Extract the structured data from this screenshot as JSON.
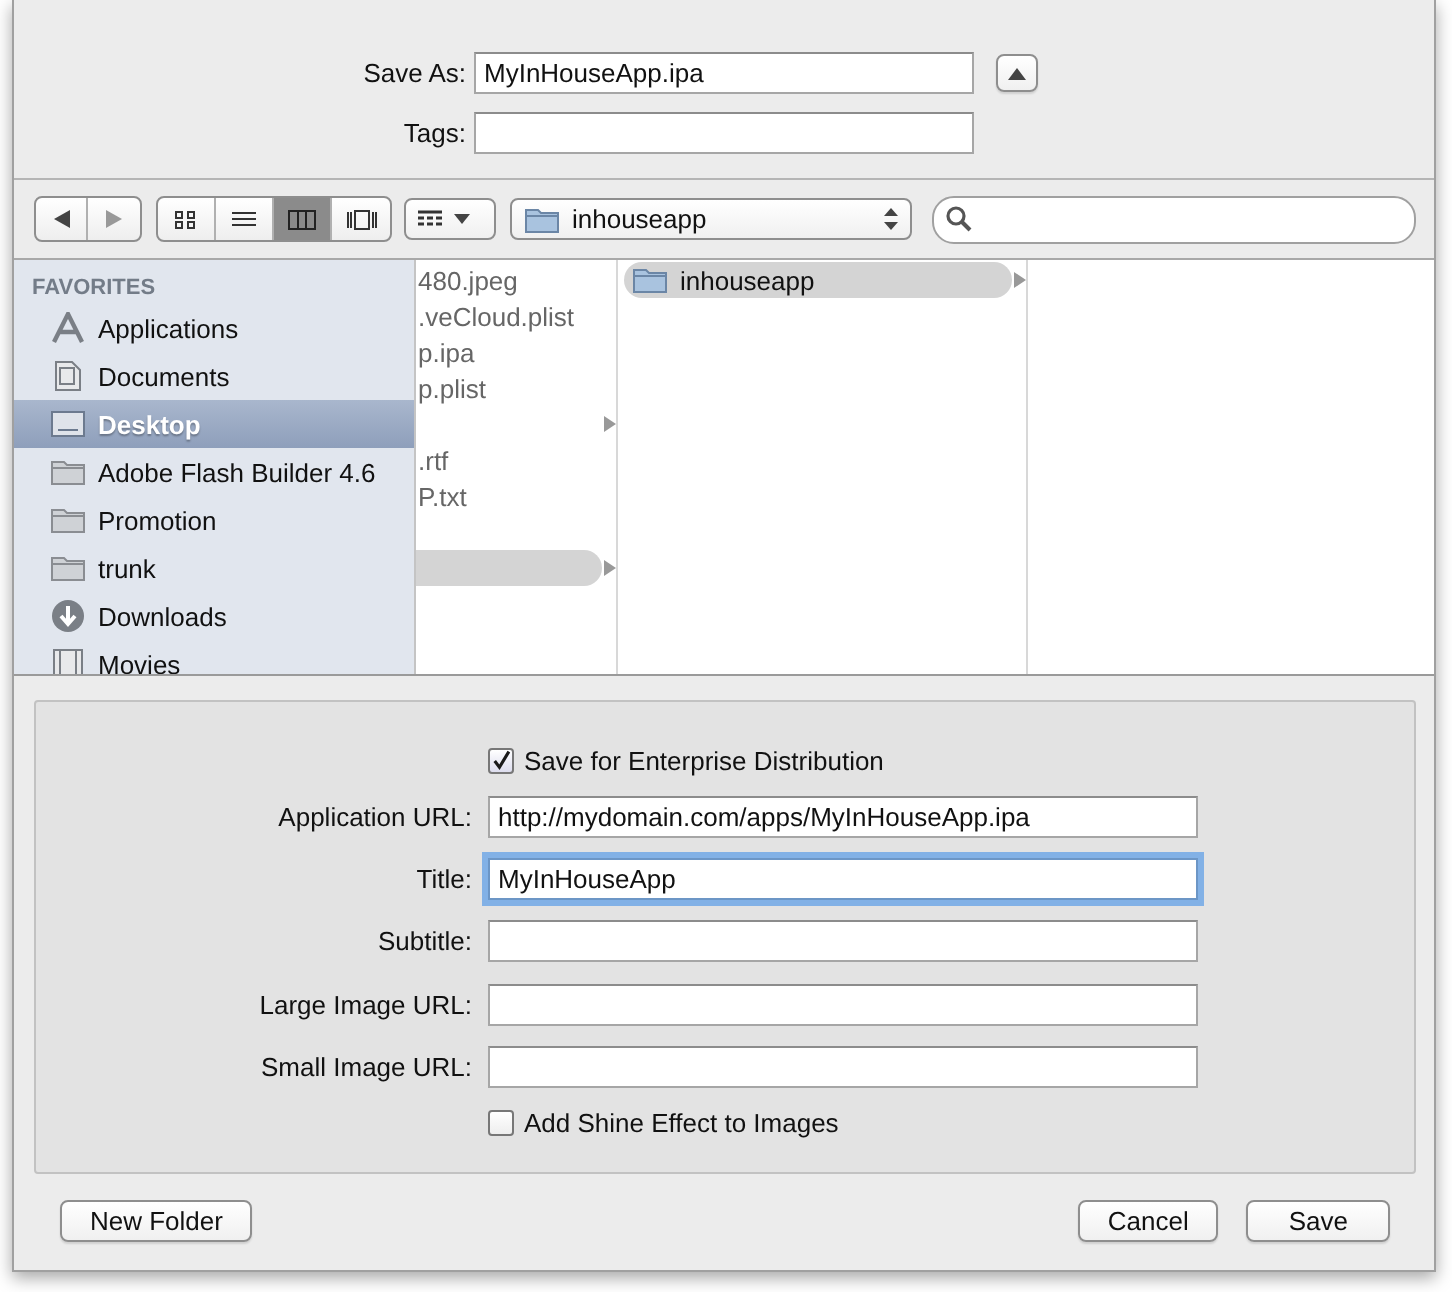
{
  "save_as": {
    "label": "Save As:",
    "value": "MyInHouseApp.ipa",
    "expanded": true
  },
  "tags": {
    "label": "Tags:"
  },
  "toolbar": {
    "view_modes": [
      {
        "kind": "icons",
        "selected": false
      },
      {
        "kind": "list",
        "selected": false
      },
      {
        "kind": "columns",
        "selected": true
      },
      {
        "kind": "coverflow",
        "selected": false
      }
    ],
    "path": "inhouseapp"
  },
  "sidebar": {
    "heading": "FAVORITES",
    "items": [
      {
        "label": "Applications",
        "kind": "apps",
        "selected": false
      },
      {
        "label": "Documents",
        "kind": "documents",
        "selected": false
      },
      {
        "label": "Desktop",
        "kind": "desktop",
        "selected": true
      },
      {
        "label": "Adobe Flash Builder 4.6",
        "kind": "folder",
        "selected": false
      },
      {
        "label": "Promotion",
        "kind": "folder",
        "selected": false
      },
      {
        "label": "trunk",
        "kind": "folder",
        "selected": false
      },
      {
        "label": "Downloads",
        "kind": "downloads",
        "selected": false
      },
      {
        "label": "Movies",
        "kind": "movies",
        "selected": false
      }
    ]
  },
  "columns": [
    {
      "items": [
        {
          "name": "480.jpeg",
          "selected": false
        },
        {
          "name": ".veCloud.plist",
          "selected": false
        },
        {
          "name": "p.ipa",
          "selected": false
        },
        {
          "name": "p.plist",
          "selected": false
        },
        {
          "has_children": true,
          "selected": false
        },
        {
          "name": ".rtf",
          "selected": false
        },
        {
          "name": "P.txt",
          "selected": false
        },
        {
          "selected": false
        },
        {
          "has_children": true,
          "selected": true
        }
      ]
    },
    {
      "items": [
        {
          "name": "inhouseapp",
          "kind": "folder",
          "has_children": true,
          "selected": true
        }
      ]
    }
  ],
  "enterprise": {
    "distribution": {
      "label": "Save for Enterprise Distribution",
      "checked": true
    },
    "fields": [
      {
        "label": "Application URL:",
        "value": "http://mydomain.com/apps/MyInHouseApp.ipa",
        "focused": false
      },
      {
        "label": "Title:",
        "value": "MyInHouseApp",
        "focused": true
      },
      {
        "label": "Subtitle:",
        "focused": false
      },
      {
        "label": "Large Image URL:",
        "focused": false
      },
      {
        "label": "Small Image URL:",
        "focused": false
      }
    ],
    "shine": {
      "label": "Add Shine Effect to Images",
      "checked": false
    }
  },
  "buttons": {
    "new_folder": "New Folder",
    "cancel": "Cancel",
    "save": "Save"
  }
}
